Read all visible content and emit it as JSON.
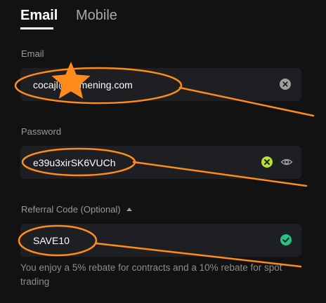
{
  "tabs": [
    {
      "label": "Email",
      "active": true
    },
    {
      "label": "Mobile",
      "active": false
    }
  ],
  "email": {
    "label": "Email",
    "value": "cocajl@gamening.com"
  },
  "password": {
    "label": "Password",
    "value": "e39u3xirSK6VUCh"
  },
  "referral": {
    "label": "Referral Code (Optional)",
    "value": "SAVE10"
  },
  "helper_text": "You enjoy a 5% rebate for contracts and a 10% rebate for spot trading",
  "colors": {
    "background": "#121212",
    "field_background": "#1e1f23",
    "annotation": "#ff8c1a",
    "valid_green": "#27c483",
    "lime": "#b8e22e"
  },
  "icons": {
    "email_field": "clear-icon",
    "password_validity": "check-icon",
    "password_visibility": "eye-icon",
    "referral_field": "check-circle-icon"
  }
}
